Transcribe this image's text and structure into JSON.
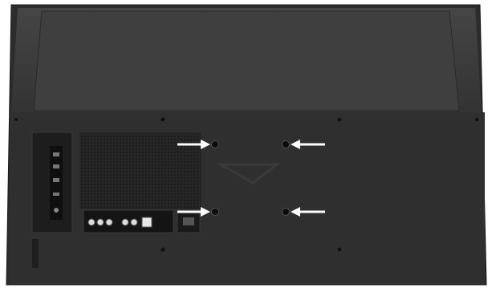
{
  "image": {
    "subject": "tv-rear-panel",
    "colors": {
      "background": "#ffffff",
      "upper_shell": "#3a3a3a",
      "lower_panel": "#2e2e2e",
      "vent_grille": "#1f1f1f",
      "port_strip": "#151515",
      "arrow": "#ffffff"
    },
    "mount_holes": 4,
    "arrows": 4
  }
}
